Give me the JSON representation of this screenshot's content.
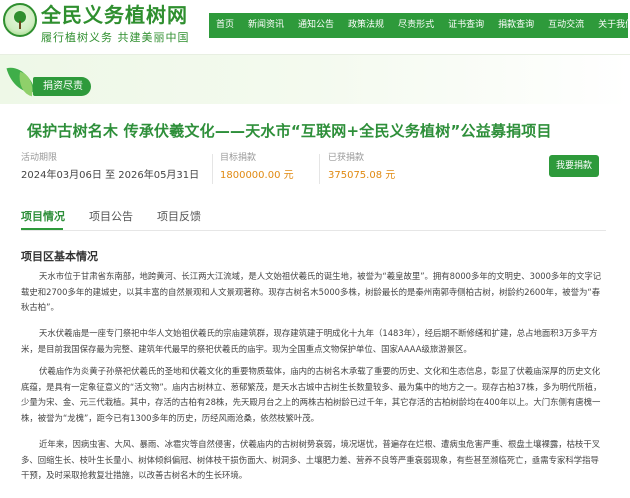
{
  "header": {
    "site_name": "全民义务植树网",
    "slogan": "履行植树义务  共建美丽中国"
  },
  "nav": {
    "items": [
      "首页",
      "新闻资讯",
      "通知公告",
      "政策法规",
      "尽责形式",
      "证书查询",
      "捐款查询",
      "互动交流",
      "关于我们"
    ]
  },
  "banner": {
    "tag": "捐资尽责"
  },
  "project": {
    "title": "保护古树名木 传承伏羲文化——天水市“互联网+全民义务植树”公益募捐项目",
    "time_label": "活动期限",
    "time_value": "2024年03月06日 至 2026年05月31日",
    "target_label": "目标捐款",
    "target_value": "1800000.00 元",
    "raised_label": "已获捐款",
    "raised_value": "375075.08 元",
    "donate_button": "我要捐款"
  },
  "tabs": [
    "项目情况",
    "项目公告",
    "项目反馈"
  ],
  "content": {
    "section_title": "项目区基本情况",
    "paragraphs": [
      "天水市位于甘肃省东南部，地跨黄河、长江两大江流域，是人文始祖伏羲氏的诞生地，被誉为“羲皇故里”。拥有8000多年的文明史、3000多年的文字记载史和2700多年的建城史，以其丰富的自然景观和人文景观著称。现存古树名木5000多株，树龄最长的是秦州南郭寺侧柏古树，树龄约2600年，被誉为“春秋古柏”。",
      "天水伏羲庙是一座专门祭祀中华人文始祖伏羲氏的宗庙建筑群，现存建筑建于明成化十九年（1483年），经后期不断修缮和扩建，总占地面积3万多平方米，是目前我国保存最为完整、建筑年代最早的祭祀伏羲氏的庙宇。现为全国重点文物保护单位、国家AAAA级旅游景区。",
      "伏羲庙作为炎黄子孙祭祀伏羲氏的圣地和伏羲文化的重要物质载体，庙内的古树名木承载了重要的历史、文化和生态信息，彰显了伏羲庙深厚的历史文化底蕴，是具有一定象征意义的“活文物”。庙内古树林立、葱郁繁茂，是天水古城中古树生长数量较多、最为集中的地方之一。现存古柏37株，多为明代所植，少量为宋、金、元三代栽植。其中，存活的古柏有28株，先天殿月台之上的两株古柏树龄已过千年，其它存活的古柏树龄均在400年以上。大门东侧有唐槐一株，被誉为“龙槐”，距今已有1300多年的历史，历经风雨沧桑，依然枝繁叶茂。",
      "近年来，因病虫害、大风、暴雨、冰雹灾等自然侵害，伏羲庙内的古树树势衰弱，境况堪忧，普遍存在烂根、遭病虫危害严重、根盘土壤裸露，枯枝干叉多、回缩生长、枝叶生长量小、树体倾斜偏冠、树体枝干损伤面大、树洞多、土壤肥力差、营养不良等严重衰弱现象，有些甚至濒临死亡，亟需专家科学指导干预，及时采取抢救复壮措施，以改善古树名木的生长环境。"
    ]
  },
  "colors": {
    "brand_green": "#2e9a3b",
    "title_green": "#2e8f3a",
    "amount_orange": "#e08a12"
  }
}
